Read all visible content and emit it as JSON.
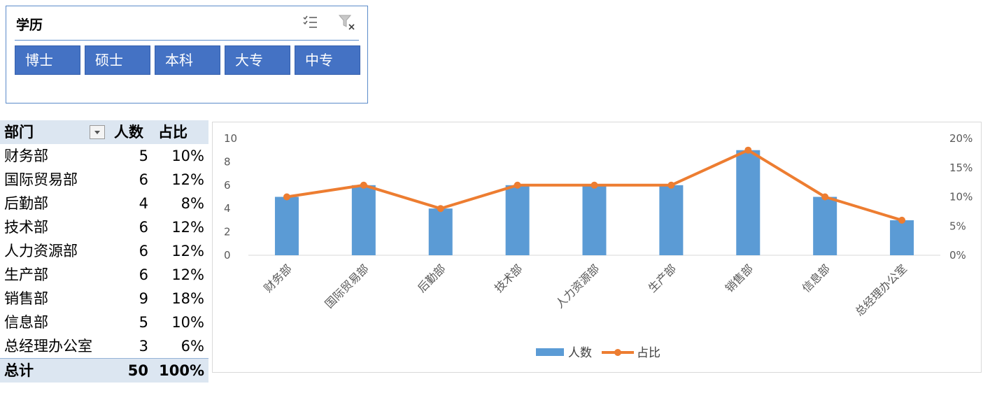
{
  "slicer": {
    "title": "学历",
    "icons": [
      "multi-select-icon",
      "clear-filter-icon"
    ],
    "items": [
      "博士",
      "硕士",
      "本科",
      "大专",
      "中专"
    ]
  },
  "pivot": {
    "headers": {
      "dept": "部门",
      "count": "人数",
      "pct": "占比"
    },
    "rows": [
      {
        "dept": "财务部",
        "count": "5",
        "pct": "10%"
      },
      {
        "dept": "国际贸易部",
        "count": "6",
        "pct": "12%"
      },
      {
        "dept": "后勤部",
        "count": "4",
        "pct": "8%"
      },
      {
        "dept": "技术部",
        "count": "6",
        "pct": "12%"
      },
      {
        "dept": "人力资源部",
        "count": "6",
        "pct": "12%"
      },
      {
        "dept": "生产部",
        "count": "6",
        "pct": "12%"
      },
      {
        "dept": "销售部",
        "count": "9",
        "pct": "18%"
      },
      {
        "dept": "信息部",
        "count": "5",
        "pct": "10%"
      },
      {
        "dept": "总经理办公室",
        "count": "3",
        "pct": "6%"
      }
    ],
    "total": {
      "label": "总计",
      "count": "50",
      "pct": "100%"
    }
  },
  "colors": {
    "bar": "#5b9bd5",
    "line": "#ed7d31",
    "slicer_item": "#4472c4",
    "header_bg": "#dce6f1"
  },
  "chart_data": {
    "type": "bar",
    "categories": [
      "财务部",
      "国际贸易部",
      "后勤部",
      "技术部",
      "人力资源部",
      "生产部",
      "销售部",
      "信息部",
      "总经理办公室"
    ],
    "series": [
      {
        "name": "人数",
        "type": "bar",
        "axis": "left",
        "values": [
          5,
          6,
          4,
          6,
          6,
          6,
          9,
          5,
          3
        ]
      },
      {
        "name": "占比",
        "type": "line",
        "axis": "right",
        "values": [
          0.1,
          0.12,
          0.08,
          0.12,
          0.12,
          0.12,
          0.18,
          0.1,
          0.06
        ]
      }
    ],
    "ylim": [
      0,
      10
    ],
    "y_ticks": [
      "0",
      "2",
      "4",
      "6",
      "8",
      "10"
    ],
    "y2lim": [
      0,
      0.2
    ],
    "y2_ticks": [
      "0%",
      "5%",
      "10%",
      "15%",
      "20%"
    ],
    "grid": false,
    "legend": "bottom"
  }
}
